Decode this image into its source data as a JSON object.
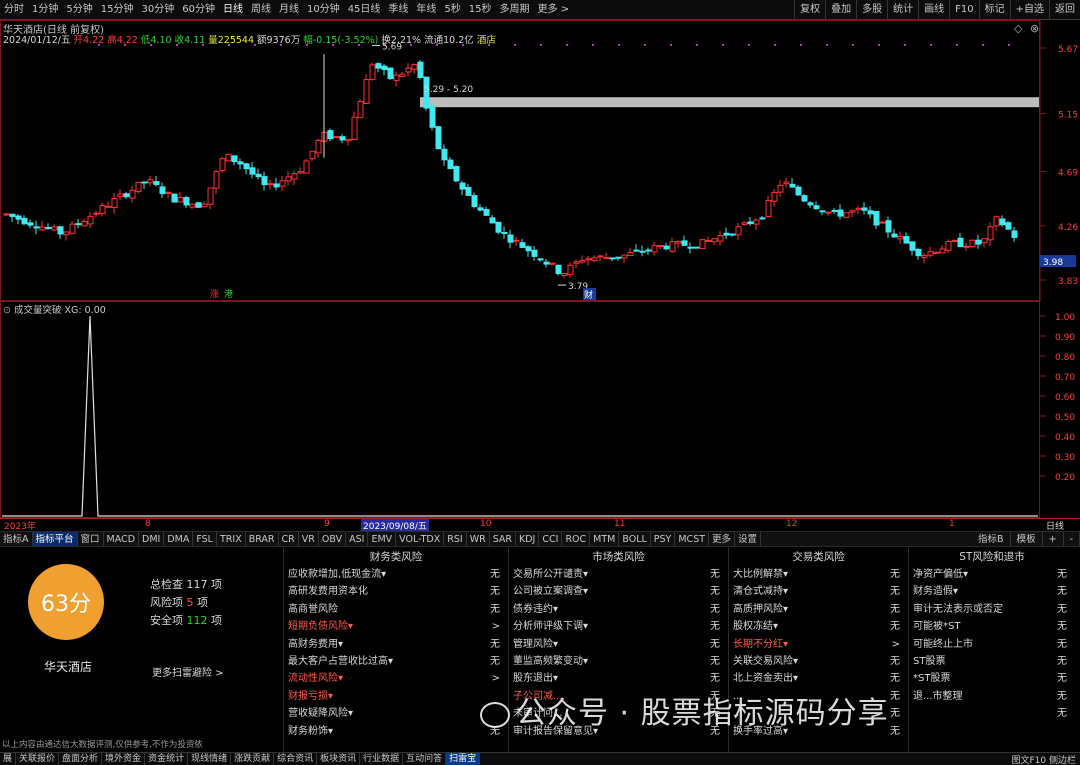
{
  "period_bar": {
    "items": [
      "分时",
      "1分钟",
      "5分钟",
      "15分钟",
      "30分钟",
      "60分钟",
      "日线",
      "周线",
      "月线",
      "10分钟",
      "45日线",
      "季线",
      "年线",
      "5秒",
      "15秒",
      "多周期",
      "更多 >"
    ],
    "active_index": 6,
    "tools": [
      "复权",
      "叠加",
      "多股",
      "统计",
      "画线",
      "F10",
      "标记",
      "+自选",
      "返回"
    ]
  },
  "chart": {
    "title": "华天酒店(日线 前复权)",
    "ohlc": {
      "date": "2024/01/12/五",
      "open": "开4.22",
      "high": "高4.22",
      "low": "低4.10",
      "close": "收4.11",
      "volume": "量225544",
      "amount": "额9376万",
      "change": "幅-0.15(-3.52%)",
      "turnover": "换2.21%",
      "float_value": "流通10.2亿",
      "industry": "酒店"
    },
    "price_axis": [
      "5.67",
      "5.15",
      "4.69",
      "4.26",
      "3.98",
      "3.83"
    ],
    "current_price": "3.98",
    "annot_high": "5.69",
    "annot_low": "3.79",
    "annot_range": "5.29 - 5.20",
    "marks": {
      "rise": "涨",
      "limit": "港",
      "fin": "财"
    }
  },
  "indicator": {
    "title": "成交量突破",
    "xg": "XG: 0.00",
    "axis": [
      "1.00",
      "0.90",
      "0.80",
      "0.70",
      "0.60",
      "0.50",
      "0.40",
      "0.30",
      "0.20"
    ]
  },
  "dates": [
    "2023年",
    "8",
    "9",
    "2023/09/08/五",
    "10",
    "11",
    "12",
    "1",
    "日线"
  ],
  "indicator_tabs": [
    "指标A",
    "指标平台",
    "窗口",
    "MACD",
    "DMI",
    "DMA",
    "FSL",
    "TRIX",
    "BRAR",
    "CR",
    "VR",
    "OBV",
    "ASI",
    "EMV",
    "VOL-TDX",
    "RSI",
    "WR",
    "SAR",
    "KDJ",
    "CCI",
    "ROC",
    "MTM",
    "BOLL",
    "PSY",
    "MCST",
    "更多",
    "设置"
  ],
  "indicator_tabs_active": 1,
  "indicator_right": [
    "指标B",
    "模板",
    "+",
    "-"
  ],
  "risk": {
    "score": "63分",
    "stock": "华天酒店",
    "summary": [
      {
        "label": "总检查",
        "value": "117",
        "unit": "项",
        "color": "#d8d8d8"
      },
      {
        "label": "风险项",
        "value": "5",
        "unit": "项",
        "color": "#ff5040"
      },
      {
        "label": "安全项",
        "value": "112",
        "unit": "项",
        "color": "#29d629"
      }
    ],
    "more": "更多扫雷避险 >",
    "disclaimer": "以上内容由通达信大数据评测,仅供参考,不作为投资依据",
    "categories": [
      {
        "title": "财务类风险",
        "items": [
          {
            "name": "应收款增加,低现金流▾",
            "value": "无",
            "hot": false
          },
          {
            "name": "高研发费用资本化",
            "value": "无",
            "hot": false
          },
          {
            "name": "高商誉风险",
            "value": "无",
            "hot": false
          },
          {
            "name": "短期负债风险▾",
            "value": ">",
            "hot": true
          },
          {
            "name": "高财务费用▾",
            "value": "无",
            "hot": false
          },
          {
            "name": "最大客户占营收比过高▾",
            "value": "无",
            "hot": false
          },
          {
            "name": "流动性风险▾",
            "value": ">",
            "hot": true
          },
          {
            "name": "财报亏损▾",
            "value": "",
            "hot": true
          },
          {
            "name": "营收疑降风险▾",
            "value": "",
            "hot": false
          },
          {
            "name": "财务粉饰▾",
            "value": "无",
            "hot": false
          }
        ]
      },
      {
        "title": "市场类风险",
        "items": [
          {
            "name": "交易所公开谴责▾",
            "value": "无",
            "hot": false
          },
          {
            "name": "公司被立案调查▾",
            "value": "无",
            "hot": false
          },
          {
            "name": "债券违约▾",
            "value": "无",
            "hot": false
          },
          {
            "name": "分析师评级下调▾",
            "value": "无",
            "hot": false
          },
          {
            "name": "管理风险▾",
            "value": "无",
            "hot": false
          },
          {
            "name": "董监高频繁变动▾",
            "value": "无",
            "hot": false
          },
          {
            "name": "股东退出▾",
            "value": "无",
            "hot": false
          },
          {
            "name": "子公司减...",
            "value": "无",
            "hot": true
          },
          {
            "name": "未审计问...",
            "value": "无",
            "hot": false
          },
          {
            "name": "审计报告保留意见▾",
            "value": "无",
            "hot": false
          }
        ]
      },
      {
        "title": "交易类风险",
        "items": [
          {
            "name": "大比例解禁▾",
            "value": "无",
            "hot": false
          },
          {
            "name": "清仓式减持▾",
            "value": "无",
            "hot": false
          },
          {
            "name": "高质押风险▾",
            "value": "无",
            "hot": false
          },
          {
            "name": "股权冻结▾",
            "value": "无",
            "hot": false
          },
          {
            "name": "长期不分红▾",
            "value": ">",
            "hot": true
          },
          {
            "name": "关联交易风险▾",
            "value": "无",
            "hot": false
          },
          {
            "name": "北上资金卖出▾",
            "value": "无",
            "hot": false
          },
          {
            "name": "...",
            "value": "无",
            "hot": false
          },
          {
            "name": "...",
            "value": "无",
            "hot": false
          },
          {
            "name": "换手率过高▾",
            "value": "无",
            "hot": false
          }
        ]
      },
      {
        "title": "ST风险和退市",
        "items": [
          {
            "name": "净资产偏低▾",
            "value": "无",
            "hot": false
          },
          {
            "name": "财务造假▾",
            "value": "无",
            "hot": false
          },
          {
            "name": "审计无法表示或否定",
            "value": "无",
            "hot": false
          },
          {
            "name": "可能被*ST",
            "value": "无",
            "hot": false
          },
          {
            "name": "可能终止上市",
            "value": "无",
            "hot": false
          },
          {
            "name": "ST股票",
            "value": "无",
            "hot": false
          },
          {
            "name": "*ST股票",
            "value": "无",
            "hot": false
          },
          {
            "name": "退...市整理",
            "value": "无",
            "hot": false
          },
          {
            "name": "",
            "value": "无",
            "hot": false
          },
          {
            "name": "",
            "value": "",
            "hot": false
          }
        ]
      }
    ]
  },
  "footer": [
    "展",
    "关联报价",
    "盘面分析",
    "境外资金",
    "资金统计",
    "现线情绪",
    "涨跌贡献",
    "综合资讯",
    "板块资讯",
    "行业数据",
    "互动问答",
    "扫雷宝"
  ],
  "footer_active": 11,
  "footer_right": "图文F10 侧边栏",
  "watermark": "公众号 · 股票指标源码分享",
  "colors": {
    "up": "#ff3030",
    "down": "#40e8f0",
    "grid": "#7a1818",
    "axis_text": "#ff3a3a"
  }
}
